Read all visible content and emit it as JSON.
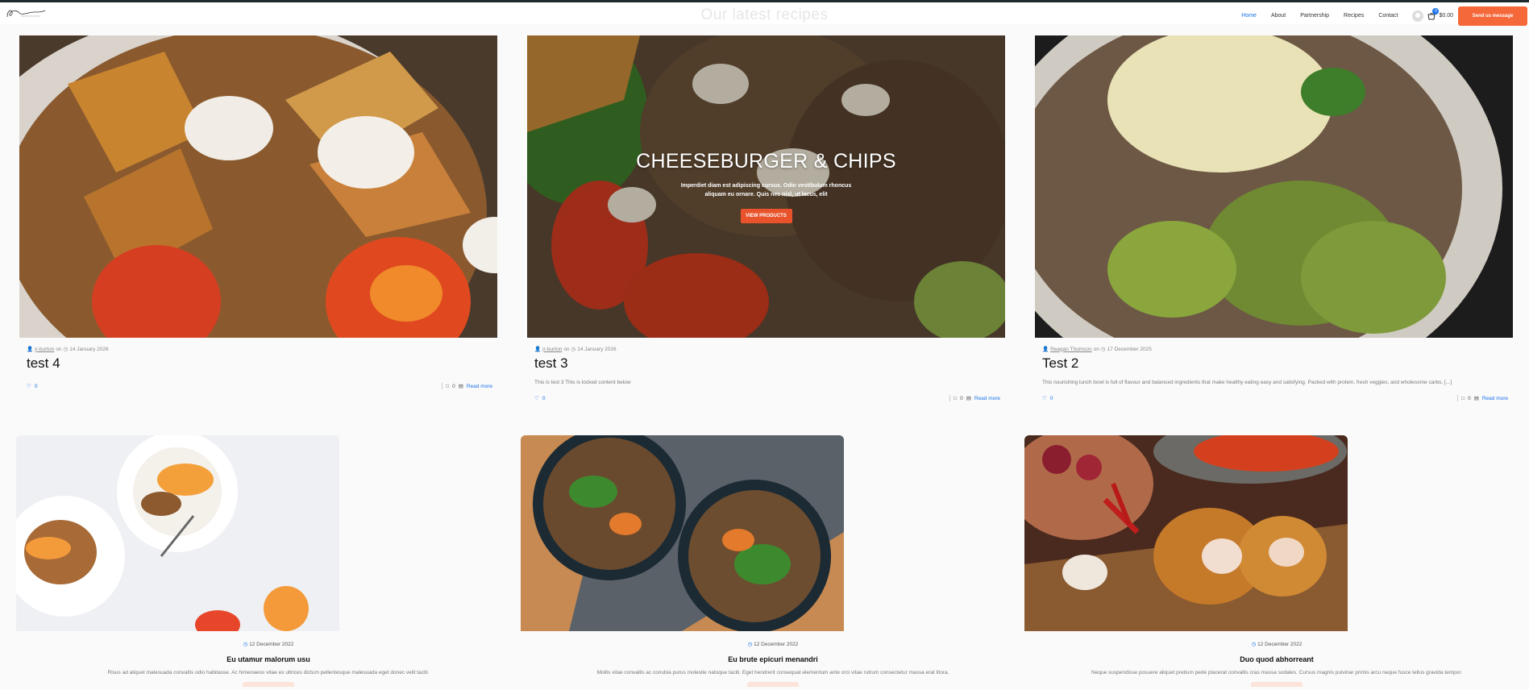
{
  "header": {
    "ghost_title": "Our latest recipes",
    "nav": [
      "Home",
      "About",
      "Partnership",
      "Recipes",
      "Contact"
    ],
    "active": "Home",
    "cart_count": "0",
    "cart_total": "$0.00",
    "cta": "Send us message"
  },
  "posts": [
    {
      "author": "jr-burton",
      "on": "on",
      "date": "14 January 2026",
      "title": "test 4",
      "excerpt": "",
      "likes": "0",
      "comments": "0",
      "read_more": "Read more"
    },
    {
      "author": "jr-burton",
      "on": "on",
      "date": "14 January 2026",
      "title": "test 3",
      "excerpt": "This is test 3 This is locked content below",
      "likes": "0",
      "comments": "0",
      "read_more": "Read more",
      "hero": {
        "heading": "CHEESEBURGER & CHIPS",
        "text": "Imperdiet diam est adipiscing cursus. Odio vestibulum rhoncus aliquam eu ornare. Quis nec nisl, ut lacus, elit",
        "button": "VIEW PRODUCTS"
      }
    },
    {
      "author": "Reagan Thomson",
      "on": "on",
      "date": "17 December 2025",
      "title": "Test 2",
      "excerpt": "This nourishing lunch bowl is full of flavour and balanced ingredients that make healthy eating easy and satisfying. Packed with protein, fresh veggies, and wholesome carbs, [...]",
      "likes": "0",
      "comments": "0",
      "read_more": "Read more"
    }
  ],
  "recipes": [
    {
      "date": "12 December 2022",
      "title": "Eu utamur malorum usu",
      "text": "Risus ad aliquet malesuada convallis odio habitasse. Ac himenaeos vitae ex ultrices dictum pellentesque malesuada eget donec velit taciti."
    },
    {
      "date": "12 December 2022",
      "title": "Eu brute epicuri menandri",
      "text": "Mollis vitae convallis ac conubia purus molestie natoque taciti. Eget hendrerit consequat elementum ante orci vitae rutrum consectetur massa erat litora."
    },
    {
      "date": "12 December 2022",
      "title": "Duo quod abhorreant",
      "text": "Neque suspendisse posuere aliquet pretium pede placerat convallis cras massa sodales. Cursus magnis pulvinar primis arcu neque fusce tellus gravida tempor."
    }
  ],
  "colors": {
    "accent": "#1a73e8",
    "cta": "#f4683a"
  }
}
